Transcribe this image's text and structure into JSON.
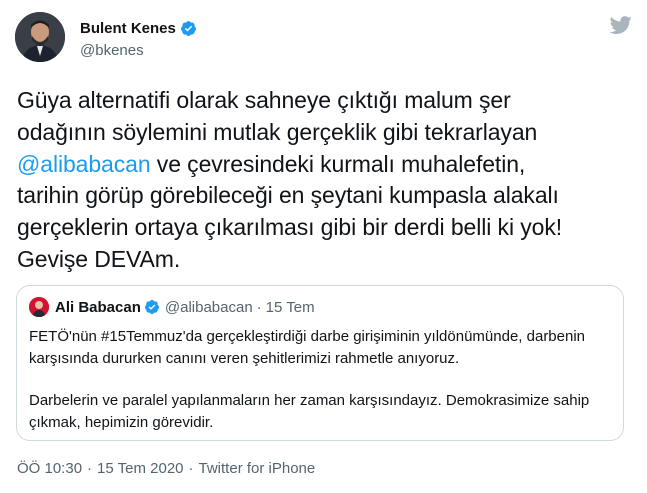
{
  "author": {
    "name": "Bulent Kenes",
    "handle": "@bkenes",
    "verified": true
  },
  "brand_icon": "twitter-bird-icon",
  "tweet": {
    "line1": "Güya alternatifi olarak sahneye çıktığı malum şer",
    "line2": "odağının söylemini mutlak gerçeklik gibi tekrarlayan",
    "mention": "@alibabacan",
    "line3_rest": " ve çevresindeki kurmalı muhalefetin,",
    "line4": "tarihin görüp görebileceği en şeytani kumpasla alakalı",
    "line5": "gerçeklerin ortaya çıkarılması gibi bir derdi belli ki yok!",
    "line6": "Gevişe DEVAm."
  },
  "quoted_tweet": {
    "name": "Ali Babacan",
    "handle": "@alibabacan",
    "separator": "·",
    "date": "15 Tem",
    "paragraph1_line1": "FETÖ'nün #15Temmuz'da gerçekleştirdiği darbe girişiminin yıldönümünde, darbenin",
    "paragraph1_line2": "karşısında dururken canını veren şehitlerimizi rahmetle anıyoruz.",
    "paragraph2_line1": "Darbelerin ve paralel yapılanmaların her zaman karşısındayız. Demokrasimize sahip",
    "paragraph2_line2": "çıkmak, hepimizin görevidir."
  },
  "meta": {
    "time": "ÖÖ 10:30",
    "separator": "·",
    "date": "15 Tem 2020",
    "source": "Twitter for iPhone"
  },
  "colors": {
    "accent": "#1d9bf0",
    "text": "#0f1419",
    "secondary": "#536471",
    "border": "#cfd9de"
  }
}
